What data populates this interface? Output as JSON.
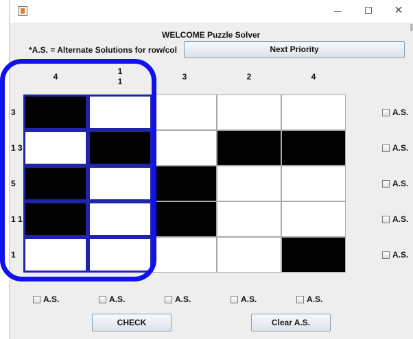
{
  "window": {
    "icon": "java-icon",
    "title": "WELCOME Puzzle Solver",
    "controls": [
      "minimize-icon",
      "maximize-icon",
      "close-icon"
    ]
  },
  "note": "*A.S. = Alternate Solutions for row/col",
  "buttons": {
    "next": "Next Priority",
    "check": "CHECK",
    "clear": "Clear A.S."
  },
  "column_clues": [
    "4",
    "1\n1",
    "3",
    "2",
    "4"
  ],
  "row_clues": [
    "3",
    "1 3",
    "5",
    "1 1",
    "1"
  ],
  "grid": [
    [
      1,
      0,
      0,
      0,
      0
    ],
    [
      0,
      1,
      0,
      1,
      1
    ],
    [
      1,
      0,
      1,
      0,
      0
    ],
    [
      1,
      0,
      1,
      0,
      0
    ],
    [
      0,
      0,
      0,
      0,
      1
    ]
  ],
  "highlighted_columns": [
    0,
    1
  ],
  "checkbox_label": "A.S.",
  "colors": {
    "filled": "#000000",
    "empty": "#ffffff",
    "highlight_border": "#1f24a8",
    "annotation": "#1111ee"
  }
}
